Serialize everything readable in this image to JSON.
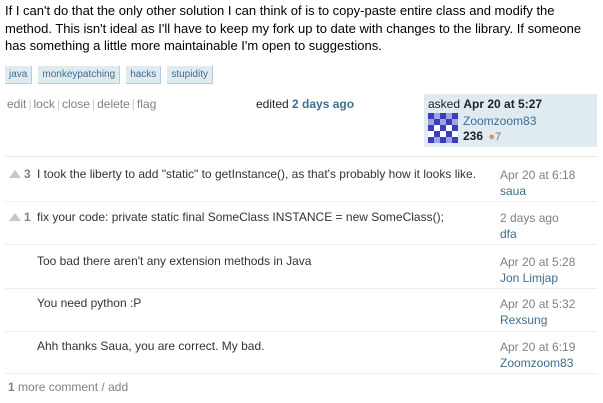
{
  "question_text": "If I can't do that the only other solution I can think of is to copy-paste entire class and modify the method. This isn't ideal as I'll have to keep my fork up to date with changes to the library. If someone has something a little more maintainable I'm open to suggestions.",
  "tags": [
    "java",
    "monkeypatching",
    "hacks",
    "stupidity"
  ],
  "post_menu": {
    "edit": "edit",
    "lock": "lock",
    "close": "close",
    "delete": "delete",
    "flag": "flag",
    "sep": "|"
  },
  "edited": {
    "label": "edited",
    "when": "2 days ago"
  },
  "owner": {
    "asked_label": "asked",
    "asked_when": "Apr 20 at 5:27",
    "username": "Zoomzoom83",
    "reputation": "236",
    "badge_dot": "●",
    "badge_count": "7"
  },
  "comments": [
    {
      "score": "3",
      "text": "I took the liberty to add \"static\" to getInstance(), as that's probably how it looks like.",
      "date": "Apr 20 at 6:18",
      "author": "saua"
    },
    {
      "score": "1",
      "text": "fix your code: private static final SomeClass INSTANCE = new SomeClass();",
      "date": "2 days ago",
      "author": "dfa"
    },
    {
      "score": "",
      "text": "Too bad there aren't any extension methods in Java",
      "date": "Apr 20 at 5:28",
      "author": "Jon Limjap"
    },
    {
      "score": "",
      "text": "You need python :P",
      "date": "Apr 20 at 5:32",
      "author": "Rexsung"
    },
    {
      "score": "",
      "text": "Ahh thanks Saua, you are correct. My bad.",
      "date": "Apr 20 at 6:19",
      "author": "Zoomzoom83"
    }
  ],
  "more_comments": {
    "count": "1",
    "label": "more comment",
    "sep": "/",
    "add": "add"
  },
  "colors": {
    "link": "#3e6d8e",
    "tag_bg": "#e0eaf1",
    "owner_bg": "#e0eaf1",
    "muted": "#808185"
  }
}
